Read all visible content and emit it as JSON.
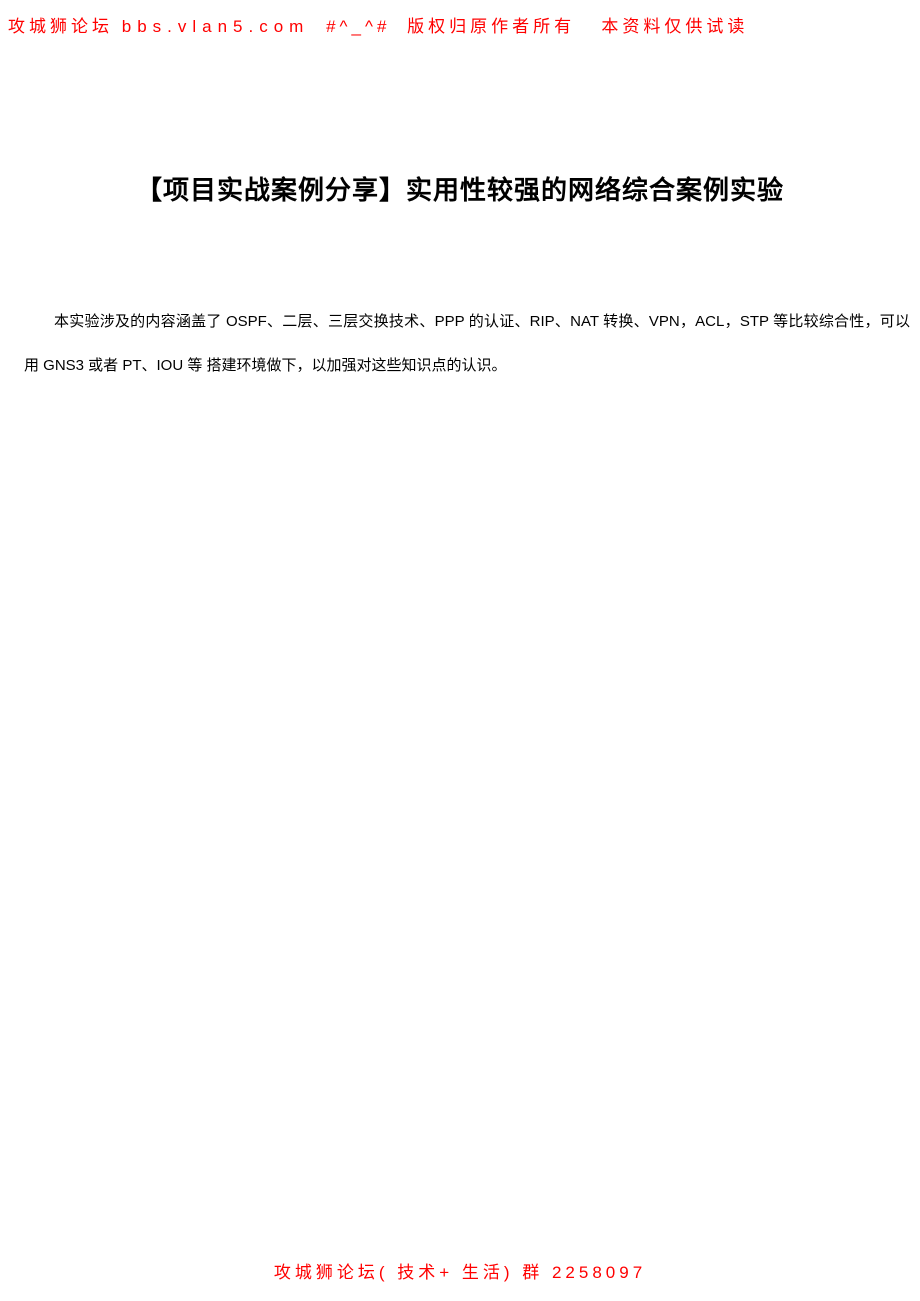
{
  "watermark": {
    "header_forum": "攻城狮论坛",
    "header_site": "bbs.vlan5.com",
    "header_deco": "#^_^#",
    "header_rights": "版权归原作者所有",
    "header_note": "本资料仅供试读",
    "footer": "攻城狮论坛( 技术+ 生活) 群  2258097"
  },
  "content": {
    "title": "【项目实战案例分享】实用性较强的网络综合案例实验",
    "paragraph": "本实验涉及的内容涵盖了 OSPF、二层、三层交换技术、PPP 的认证、RIP、NAT 转换、VPN，ACL，STP 等比较综合性，可以用 GNS3 或者 PT、IOU 等 搭建环境做下，以加强对这些知识点的认识。"
  }
}
